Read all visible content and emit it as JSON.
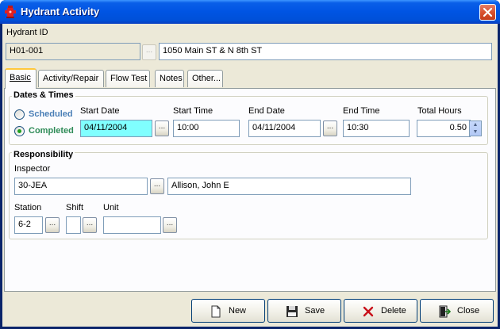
{
  "window": {
    "title": "Hydrant Activity"
  },
  "hydrant": {
    "label": "Hydrant ID",
    "id_value": "H01-001",
    "ellipsis": "...",
    "address": "1050 Main ST & N 8th ST"
  },
  "tabs": [
    {
      "label": "Basic",
      "underline": "B",
      "active": true
    },
    {
      "label": "Activity/Repair",
      "underline": "R"
    },
    {
      "label": "Flow Test",
      "underline": "T"
    },
    {
      "label": "Notes",
      "underline": "N"
    },
    {
      "label": "Other...",
      "underline": "O"
    }
  ],
  "dates": {
    "group_title": "Dates & Times",
    "scheduled_label": "Scheduled",
    "completed_label": "Completed",
    "selected": "Completed",
    "start_date_label": "Start Date",
    "start_date": "04/11/2004",
    "start_time_label": "Start Time",
    "start_time": "10:00",
    "end_date_label": "End Date",
    "end_date": "04/11/2004",
    "end_time_label": "End Time",
    "end_time": "10:30",
    "total_hours_label": "Total Hours",
    "total_hours": "0.50",
    "ellipsis": "..."
  },
  "responsibility": {
    "group_title": "Responsibility",
    "inspector_label": "Inspector",
    "inspector_code": "30-JEA",
    "inspector_name": "Allison, John E",
    "station_label": "Station",
    "station": "6-2",
    "shift_label": "Shift",
    "shift": "",
    "unit_label": "Unit",
    "unit": "",
    "ellipsis": "..."
  },
  "buttons": {
    "new": "New",
    "save": "Save",
    "delete": "Delete",
    "close": "Close"
  },
  "colors": {
    "title_bar": "#0054e3",
    "highlight_field": "#80ffff",
    "tab_active_accent": "#ffc83c",
    "completed_radio": "#21a121"
  }
}
